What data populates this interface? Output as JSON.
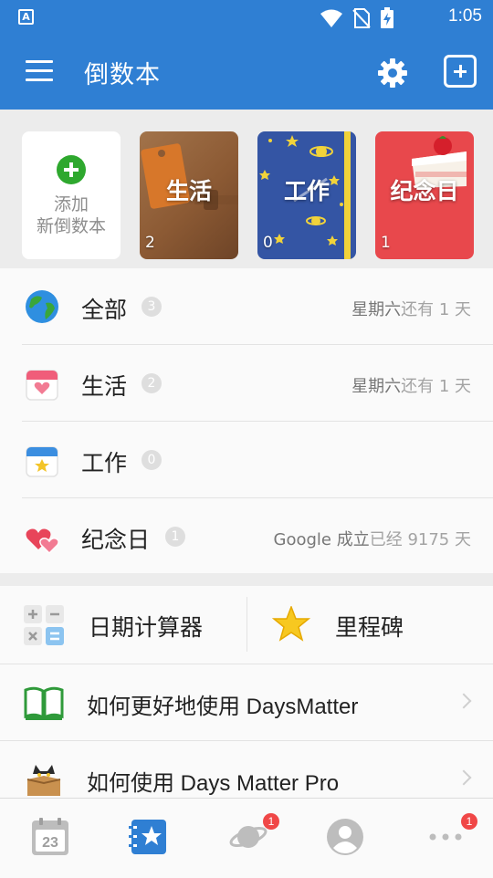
{
  "status_bar": {
    "time": "1:05",
    "app_badge": "A"
  },
  "app_bar": {
    "title": "倒数本"
  },
  "books": {
    "add_line1": "添加",
    "add_line2": "新倒数本",
    "items": [
      {
        "name": "生活",
        "count": "2"
      },
      {
        "name": "工作",
        "count": "0"
      },
      {
        "name": "纪念日",
        "count": "1"
      }
    ]
  },
  "categories": [
    {
      "name": "全部",
      "count": "3",
      "info_main": "星期六",
      "info_light": "还有 1 天"
    },
    {
      "name": "生活",
      "count": "2",
      "info_main": "星期六",
      "info_light": "还有 1 天"
    },
    {
      "name": "工作",
      "count": "0",
      "info_main": "",
      "info_light": ""
    },
    {
      "name": "纪念日",
      "count": "1",
      "info_main": "Google 成立",
      "info_light": "已经 9175 天"
    }
  ],
  "tools": {
    "date_calculator": "日期计算器",
    "milestone": "里程碑"
  },
  "guides": [
    {
      "label": "如何更好地使用 DaysMatter"
    },
    {
      "label": "如何使用 Days Matter Pro"
    }
  ],
  "tabbar": {
    "calendar_day": "23",
    "planet_badge": "1",
    "more_badge": "1"
  },
  "colors": {
    "primary": "#2f7fd3",
    "green": "#2ea82e",
    "red_badge": "#f04747"
  }
}
